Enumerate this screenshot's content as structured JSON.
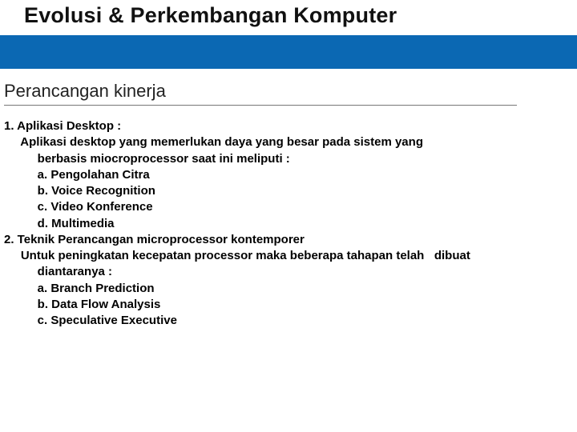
{
  "header": {
    "title": "Evolusi & Perkembangan Komputer"
  },
  "section": {
    "heading": "Perancangan kinerja"
  },
  "lines": {
    "l0": "1. Aplikasi Desktop :",
    "l1": "     Aplikasi desktop yang memerlukan daya yang besar pada sistem yang",
    "l2": "          berbasis miocroprocessor saat ini meliputi :",
    "l3": "          a. Pengolahan Citra",
    "l4": "          b. Voice Recognition",
    "l5": "          c. Video Konference",
    "l6": "          d. Multimedia",
    "l7": "2. Teknik Perancangan microprocessor kontemporer",
    "l8": "     Untuk peningkatan kecepatan processor maka beberapa tahapan telah   dibuat",
    "l9": "          diantaranya :",
    "l10": "          a. Branch Prediction",
    "l11": "          b. Data Flow Analysis",
    "l12": "          c. Speculative Executive"
  }
}
